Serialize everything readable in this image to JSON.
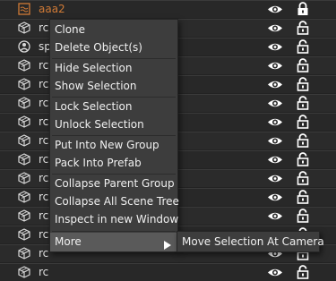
{
  "tree": {
    "rows": [
      {
        "label": "aaa2",
        "icon": "prefab-icon",
        "color": "#d07a36"
      },
      {
        "label": "rc",
        "icon": "cube-icon"
      },
      {
        "label": "sp",
        "icon": "sphere-icon"
      },
      {
        "label": "rc",
        "icon": "cube-icon"
      },
      {
        "label": "rc",
        "icon": "cube-icon"
      },
      {
        "label": "rc",
        "icon": "cube-icon"
      },
      {
        "label": "rc",
        "icon": "cube-icon"
      },
      {
        "label": "rc",
        "icon": "cube-icon"
      },
      {
        "label": "rc",
        "icon": "cube-icon"
      },
      {
        "label": "rc",
        "icon": "cube-icon"
      },
      {
        "label": "rc",
        "icon": "cube-icon"
      },
      {
        "label": "rc",
        "icon": "cube-icon"
      },
      {
        "label": "rc",
        "icon": "cube-icon"
      },
      {
        "label": "rc",
        "icon": "cube-icon"
      },
      {
        "label": "rc",
        "icon": "cube-icon"
      }
    ]
  },
  "context_menu": {
    "items": [
      "Clone",
      "Delete Object(s)",
      "Hide Selection",
      "Show Selection",
      "Lock Selection",
      "Unlock Selection",
      "Put Into New Group",
      "Pack Into Prefab",
      "Collapse Parent Group",
      "Collapse All Scene Tree",
      "Inspect in new Window",
      "More"
    ],
    "submenu": {
      "items": [
        "Move Selection At Camera"
      ]
    }
  },
  "colors": {
    "background": "#232323",
    "menu_bg": "#3d3d3d",
    "hover": "#5a5a5a",
    "prefab_label": "#d07a36"
  }
}
